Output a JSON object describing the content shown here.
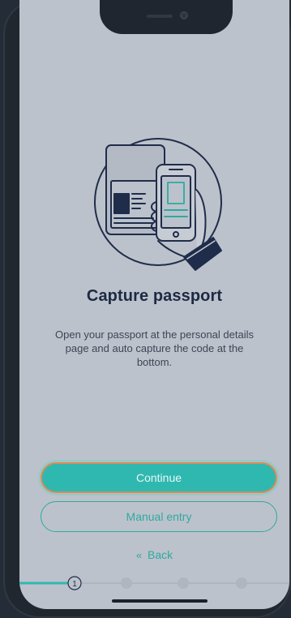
{
  "screen": {
    "title": "Capture passport",
    "description": "Open your passport at the personal details page and auto capture the code at the bottom."
  },
  "actions": {
    "continue_label": "Continue",
    "manual_entry_label": "Manual entry",
    "back_label": "Back",
    "back_icon": "double-chevron-left-icon"
  },
  "progress": {
    "current_step_label": "1",
    "total_steps": 4,
    "current_step": 1
  },
  "colors": {
    "accent": "#2fb8b0",
    "title": "#1c2a44",
    "screen_background": "#bcc2cb",
    "button_outline": "#e08a55"
  }
}
